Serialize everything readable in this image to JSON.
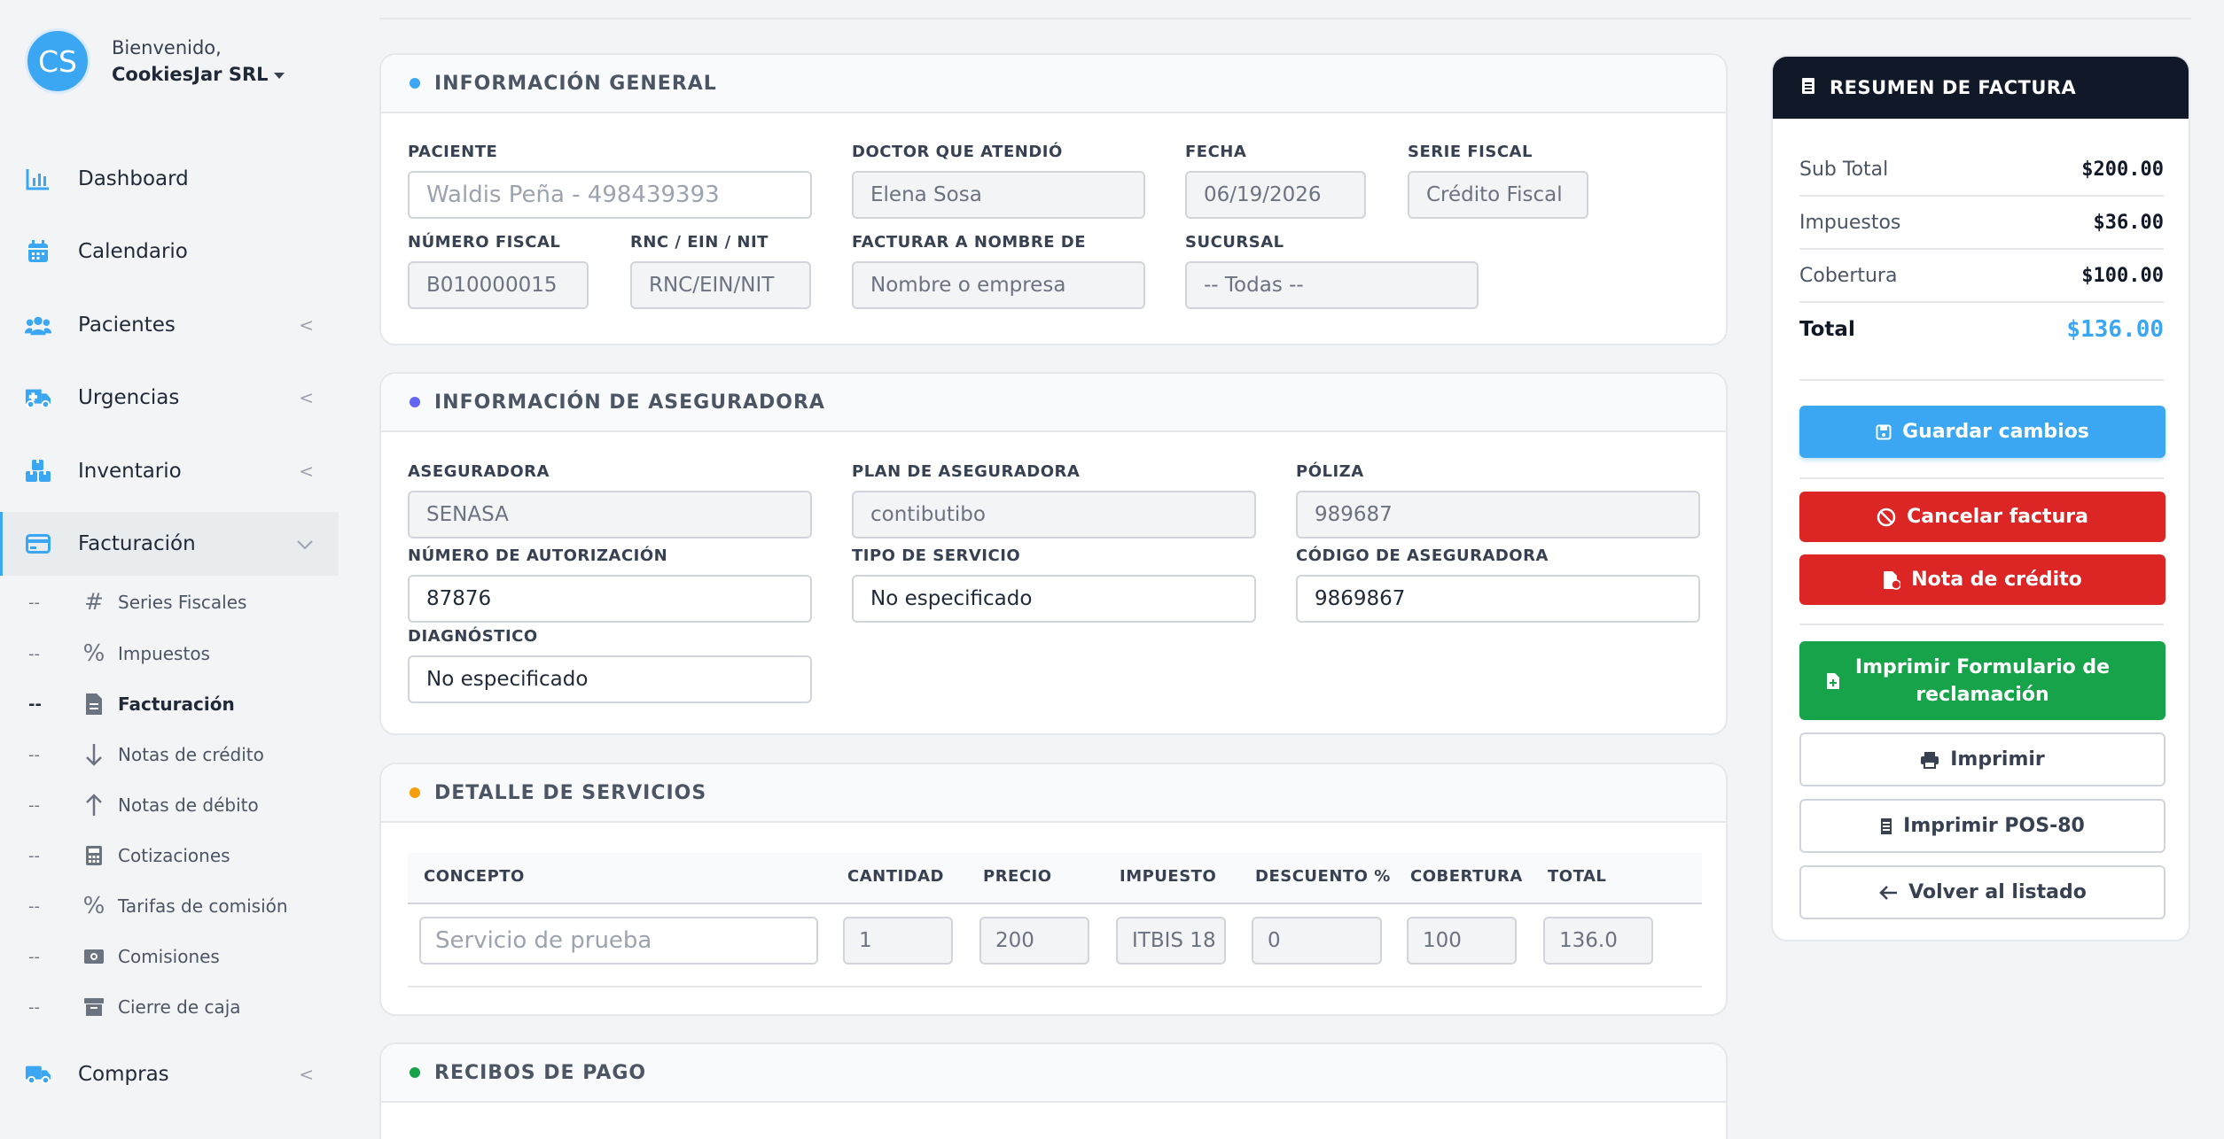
{
  "user": {
    "initials": "CS",
    "welcome": "Bienvenido,",
    "company": "CookiesJar SRL"
  },
  "nav": {
    "items": [
      {
        "label": "Dashboard"
      },
      {
        "label": "Calendario"
      },
      {
        "label": "Pacientes"
      },
      {
        "label": "Urgencias"
      },
      {
        "label": "Inventario"
      },
      {
        "label": "Facturación"
      },
      {
        "label": "Compras"
      }
    ],
    "submenu": [
      {
        "label": "Series Fiscales"
      },
      {
        "label": "Impuestos"
      },
      {
        "label": "Facturación"
      },
      {
        "label": "Notas de crédito"
      },
      {
        "label": "Notas de débito"
      },
      {
        "label": "Cotizaciones"
      },
      {
        "label": "Tarifas de comisión"
      },
      {
        "label": "Comisiones"
      },
      {
        "label": "Cierre de caja"
      }
    ],
    "dash": "--",
    "chevron": "<"
  },
  "general": {
    "title": "INFORMACIÓN GENERAL",
    "paciente": {
      "label": "PACIENTE",
      "value": "Waldis Peña - 498439393"
    },
    "doctor": {
      "label": "DOCTOR QUE ATENDIÓ",
      "value": "Elena Sosa"
    },
    "fecha": {
      "label": "FECHA",
      "value": "06/19/2026"
    },
    "serie": {
      "label": "SERIE FISCAL",
      "value": "Crédito Fiscal"
    },
    "numero": {
      "label": "NÚMERO FISCAL",
      "value": "B010000015"
    },
    "rnc": {
      "label": "RNC / EIN / NIT",
      "placeholder": "RNC/EIN/NIT"
    },
    "facturar": {
      "label": "FACTURAR A NOMBRE DE",
      "placeholder": "Nombre o empresa"
    },
    "sucursal": {
      "label": "SUCURSAL",
      "value": "-- Todas --"
    }
  },
  "insurance": {
    "title": "INFORMACIÓN DE ASEGURADORA",
    "aseguradora": {
      "label": "ASEGURADORA",
      "value": "SENASA"
    },
    "plan": {
      "label": "PLAN DE ASEGURADORA",
      "value": "contibutibo"
    },
    "poliza": {
      "label": "PÓLIZA",
      "value": "989687"
    },
    "autorizacion": {
      "label": "NÚMERO DE AUTORIZACIÓN",
      "value": "87876"
    },
    "tipo": {
      "label": "TIPO DE SERVICIO",
      "value": "No especificado"
    },
    "codigo": {
      "label": "CÓDIGO DE ASEGURADORA",
      "value": "9869867"
    },
    "diagnostico": {
      "label": "DIAGNÓSTICO",
      "value": "No especificado"
    }
  },
  "services": {
    "title": "DETALLE DE SERVICIOS",
    "headers": [
      "CONCEPTO",
      "CANTIDAD",
      "PRECIO",
      "IMPUESTO",
      "DESCUENTO %",
      "COBERTURA",
      "TOTAL"
    ],
    "row": {
      "concepto": "Servicio de prueba",
      "cantidad": "1",
      "precio": "200",
      "impuesto": "ITBIS 18",
      "descuento": "0",
      "cobertura": "100",
      "total": "136.0"
    }
  },
  "receipts": {
    "title": "RECIBOS DE PAGO"
  },
  "summary": {
    "title": "RESUMEN DE FACTURA",
    "subtotal": {
      "label": "Sub Total",
      "value": "$200.00"
    },
    "impuestos": {
      "label": "Impuestos",
      "value": "$36.00"
    },
    "cobertura": {
      "label": "Cobertura",
      "value": "$100.00"
    },
    "total": {
      "label": "Total",
      "value": "$136.00"
    },
    "buttons": {
      "guardar": "Guardar cambios",
      "cancelar": "Cancelar factura",
      "nota": "Nota de crédito",
      "formulario": "Imprimir Formulario de reclamación",
      "imprimir": "Imprimir",
      "pos": "Imprimir POS-80",
      "volver": "Volver al listado"
    }
  },
  "colors": {
    "accent": "#3ba7f3",
    "danger": "#dc2626",
    "success": "#16a34a",
    "dark": "#111827"
  }
}
